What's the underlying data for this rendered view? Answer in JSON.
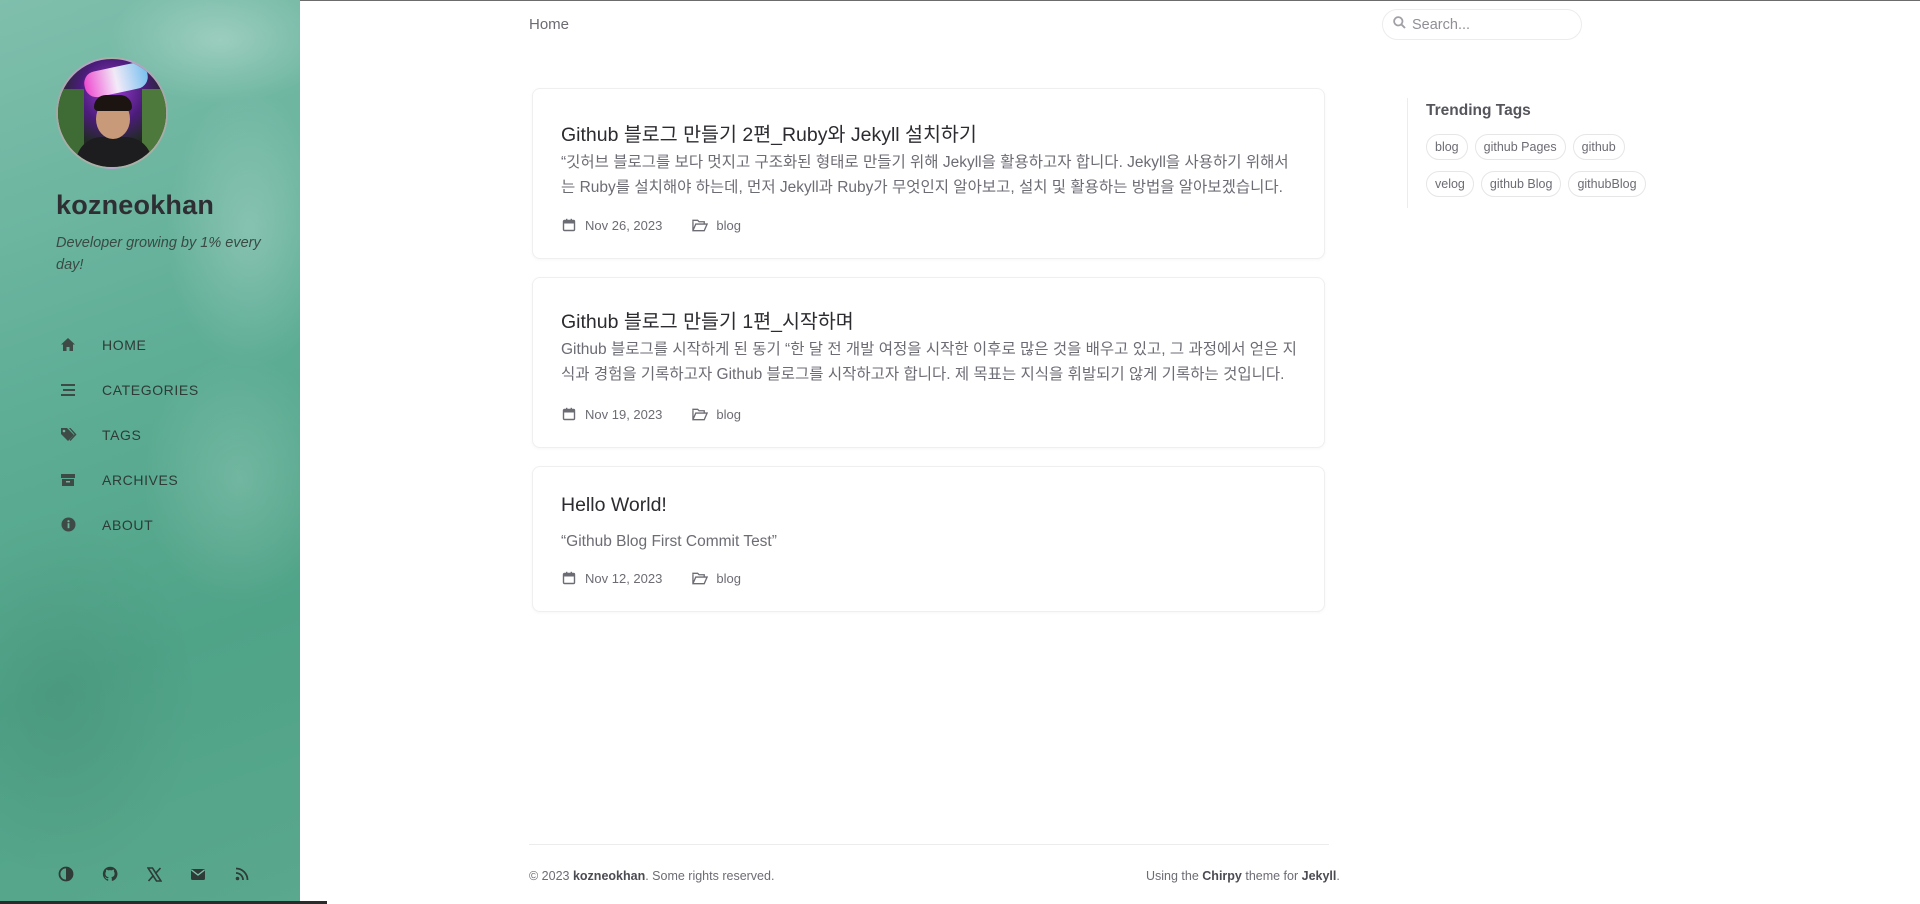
{
  "sidebar": {
    "site_title": "kozneokhan",
    "subtitle": "Developer growing by 1% every day!",
    "nav": [
      {
        "label": "HOME",
        "icon": "home-icon"
      },
      {
        "label": "CATEGORIES",
        "icon": "stream-icon"
      },
      {
        "label": "TAGS",
        "icon": "tags-icon"
      },
      {
        "label": "ARCHIVES",
        "icon": "archive-icon"
      },
      {
        "label": "ABOUT",
        "icon": "info-circle-icon"
      }
    ],
    "footer_icons": [
      "theme-toggle-icon",
      "github-icon",
      "x-twitter-icon",
      "email-icon",
      "rss-icon"
    ]
  },
  "topbar": {
    "breadcrumb": "Home",
    "search_placeholder": "Search..."
  },
  "posts": [
    {
      "title": "Github 블로그 만들기 2편_Ruby와 Jekyll 설치하기",
      "excerpt": "“깃허브 블로그를 보다 멋지고 구조화된 형태로 만들기 위해 Jekyll을 활용하고자 합니다. Jekyll을 사용하기 위해서는 Ruby를 설치해야 하는데, 먼저 Jekyll과 Ruby가 무엇인지 알아보고, 설치 및 활용하는 방법을 알아보겠습니다.",
      "date": "Nov 26, 2023",
      "category": "blog"
    },
    {
      "title": "Github 블로그 만들기 1편_시작하며",
      "excerpt": "Github 블로그를 시작하게 된 동기 “한 달 전 개발 여정을 시작한 이후로 많은 것을 배우고 있고, 그 과정에서 얻은 지식과 경험을 기록하고자 Github 블로그를 시작하고자 합니다. 제 목표는 지식을 휘발되기 않게 기록하는 것입니다.",
      "date": "Nov 19, 2023",
      "category": "blog"
    },
    {
      "title": "Hello World!",
      "excerpt": "“Github Blog First Commit Test”",
      "date": "Nov 12, 2023",
      "category": "blog"
    }
  ],
  "trending": {
    "title": "Trending Tags",
    "tags": [
      "blog",
      "github Pages",
      "github",
      "velog",
      "github Blog",
      "githubBlog"
    ]
  },
  "footer": {
    "copyright_prefix": "© 2023 ",
    "copyright_name": "kozneokhan",
    "copyright_suffix": ". Some rights reserved.",
    "using": "Using the ",
    "theme": "Chirpy",
    "theme_for": " theme for ",
    "engine": "Jekyll",
    "end": "."
  }
}
